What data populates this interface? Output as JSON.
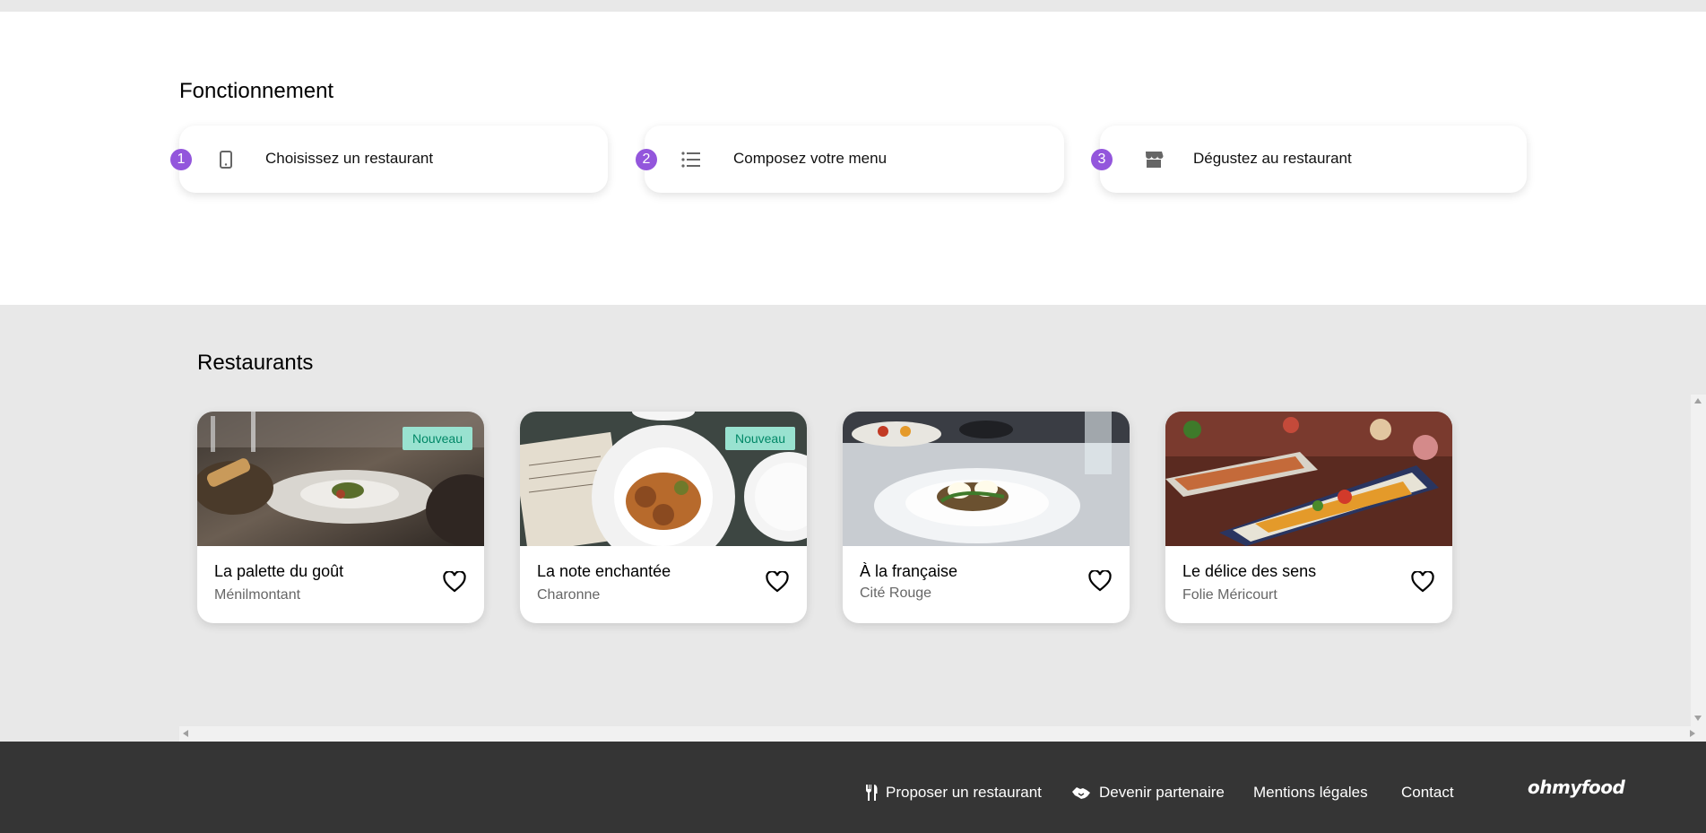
{
  "how": {
    "title": "Fonctionnement",
    "steps": [
      {
        "num": "1",
        "icon": "phone-icon",
        "label": "Choisissez un restaurant"
      },
      {
        "num": "2",
        "icon": "list-icon",
        "label": "Composez votre menu"
      },
      {
        "num": "3",
        "icon": "store-icon",
        "label": "Dégustez au restaurant"
      }
    ]
  },
  "restaurants": {
    "title": "Restaurants",
    "cards": [
      {
        "name": "La palette du goût",
        "location": "Ménilmontant",
        "badge": "Nouveau"
      },
      {
        "name": "La note enchantée",
        "location": "Charonne",
        "badge": "Nouveau"
      },
      {
        "name": "À la française",
        "location": "Cité Rouge",
        "badge": ""
      },
      {
        "name": "Le délice des sens",
        "location": "Folie Méricourt",
        "badge": ""
      }
    ]
  },
  "footer": {
    "links": [
      {
        "label": "Proposer un restaurant",
        "icon": "utensils-icon"
      },
      {
        "label": "Devenir partenaire",
        "icon": "handshake-icon"
      },
      {
        "label": "Mentions légales"
      },
      {
        "label": "Contact"
      }
    ],
    "logo": "ohmyfood"
  },
  "colors": {
    "accent": "#9356dc",
    "badge_bg": "#99e2d0",
    "badge_text": "#008766",
    "footer_bg": "#353535"
  }
}
